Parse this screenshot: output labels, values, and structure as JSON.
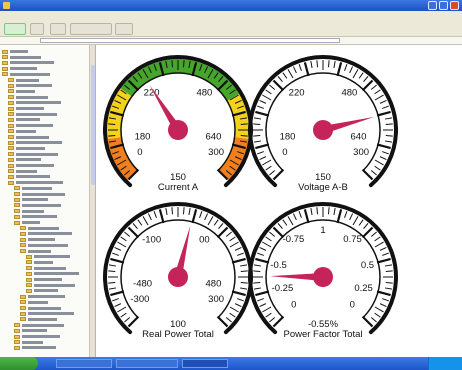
{
  "window": {
    "title": ""
  },
  "menus": [],
  "taskbar": {
    "start_label": "",
    "tasks": [],
    "clock": ""
  },
  "gauges": [
    {
      "id": "current",
      "title": "Current A",
      "value_text": "150",
      "value": 0.38,
      "scale_labels": [
        "0",
        "180",
        "220",
        "480",
        "640",
        "300"
      ],
      "bands": [
        {
          "from": 0.0,
          "to": 0.14,
          "color": "#f07f1e"
        },
        {
          "from": 0.14,
          "to": 0.3,
          "color": "#f2d21b"
        },
        {
          "from": 0.3,
          "to": 0.72,
          "color": "#46a52b"
        },
        {
          "from": 0.72,
          "to": 0.86,
          "color": "#f2d21b"
        },
        {
          "from": 0.86,
          "to": 1.0,
          "color": "#f07f1e"
        }
      ]
    },
    {
      "id": "voltage",
      "title": "Voltage A-B",
      "value_text": "150",
      "value": 0.78,
      "scale_labels": [
        "0",
        "180",
        "220",
        "480",
        "640",
        "300"
      ],
      "bands": []
    },
    {
      "id": "real-power",
      "title": "Real Power Total",
      "value_text": "100",
      "value": 0.55,
      "scale_labels": [
        "-300",
        "-480",
        "-100",
        "00",
        "480",
        "300"
      ],
      "bands": []
    },
    {
      "id": "power-factor",
      "title": "Power Factor Total",
      "value_text": "-0.55%",
      "value": 0.17,
      "scale_labels": [
        "0",
        "-0.25",
        "-0.5",
        "-0.75",
        "1",
        "0.75",
        "0.5",
        "0.25",
        "0"
      ],
      "bands": []
    }
  ],
  "colors": {
    "needle": "#c4245a",
    "bezel": "#111111",
    "taskbar": "#2456d0",
    "start": "#3aa23a"
  }
}
